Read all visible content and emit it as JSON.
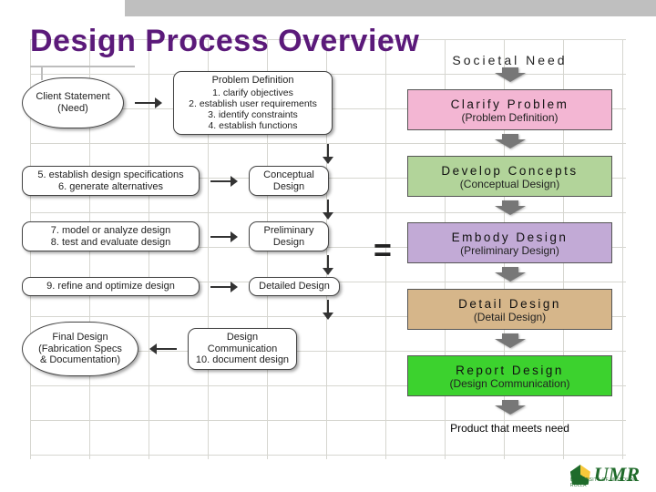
{
  "title": "Design Process Overview",
  "left": {
    "client": "Client Statement\n(Need)",
    "probdef": {
      "header": "Problem Definition",
      "items": [
        "1. clarify objectives",
        "2. establish user requirements",
        "3. identify constraints",
        "4. establish functions"
      ]
    },
    "row2_box": "5. establish design specifications\n6. generate alternatives",
    "row2_stage": "Conceptual\nDesign",
    "row3_box": "7. model or analyze design\n8. test and evaluate design",
    "row3_stage": "Preliminary\nDesign",
    "row4_box": "9. refine and optimize design",
    "row4_stage": "Detailed Design",
    "final_oval": "Final Design\n(Fabrication Specs\n& Documentation)",
    "comm_box": "Design\nCommunication\n10. document design"
  },
  "equals": "=",
  "right": {
    "top_label": "Societal Need",
    "stages": [
      {
        "t1": "Clarify Problem",
        "t2": "(Problem Definition)",
        "class": "c-pink"
      },
      {
        "t1": "Develop Concepts",
        "t2": "(Conceptual Design)",
        "class": "c-green2"
      },
      {
        "t1": "Embody Design",
        "t2": "(Preliminary Design)",
        "class": "c-purple"
      },
      {
        "t1": "Detail Design",
        "t2": "(Detail Design)",
        "class": "c-tan"
      },
      {
        "t1": "Report Design",
        "t2": "(Design Communication)",
        "class": "c-green"
      }
    ],
    "bottom_label": "Product that meets need"
  },
  "logo": {
    "text": "UMR",
    "sub": "UNIVERSITY OF MISSOURI-ROLLA"
  }
}
